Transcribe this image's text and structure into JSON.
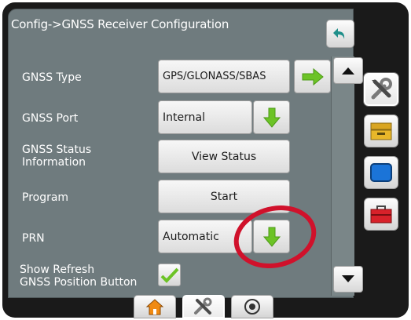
{
  "header": {
    "title": "Config->GNSS Receiver Configuration"
  },
  "rows": [
    {
      "label": "GNSS Type",
      "value": "GPS/GLONASS/SBAS"
    },
    {
      "label": "GNSS Port",
      "value": "Internal"
    },
    {
      "label_line1": "GNSS Status",
      "label_line2": "Information",
      "button": "View Status"
    },
    {
      "label": "Program",
      "button": "Start"
    },
    {
      "label": "PRN",
      "value": "Automatic"
    },
    {
      "label_line1": "Show Refresh",
      "label_line2": "GNSS Position Button",
      "checked": true
    }
  ],
  "icons": {
    "back": "back-arrow-icon",
    "next": "right-arrow-icon",
    "down": "down-arrow-icon",
    "scroll_up": "scroll-up-icon",
    "scroll_down": "scroll-down-icon",
    "side_tabs": [
      "tools-icon",
      "console-icon",
      "display-icon",
      "toolbox-icon"
    ],
    "bottom_tabs": [
      "home-icon",
      "tools-icon",
      "guidance-icon"
    ]
  },
  "colors": {
    "panel": "#6f7b7e",
    "accent_green": "#6cc326",
    "highlight": "#d0112b",
    "back_teal": "#1f8f8a"
  }
}
